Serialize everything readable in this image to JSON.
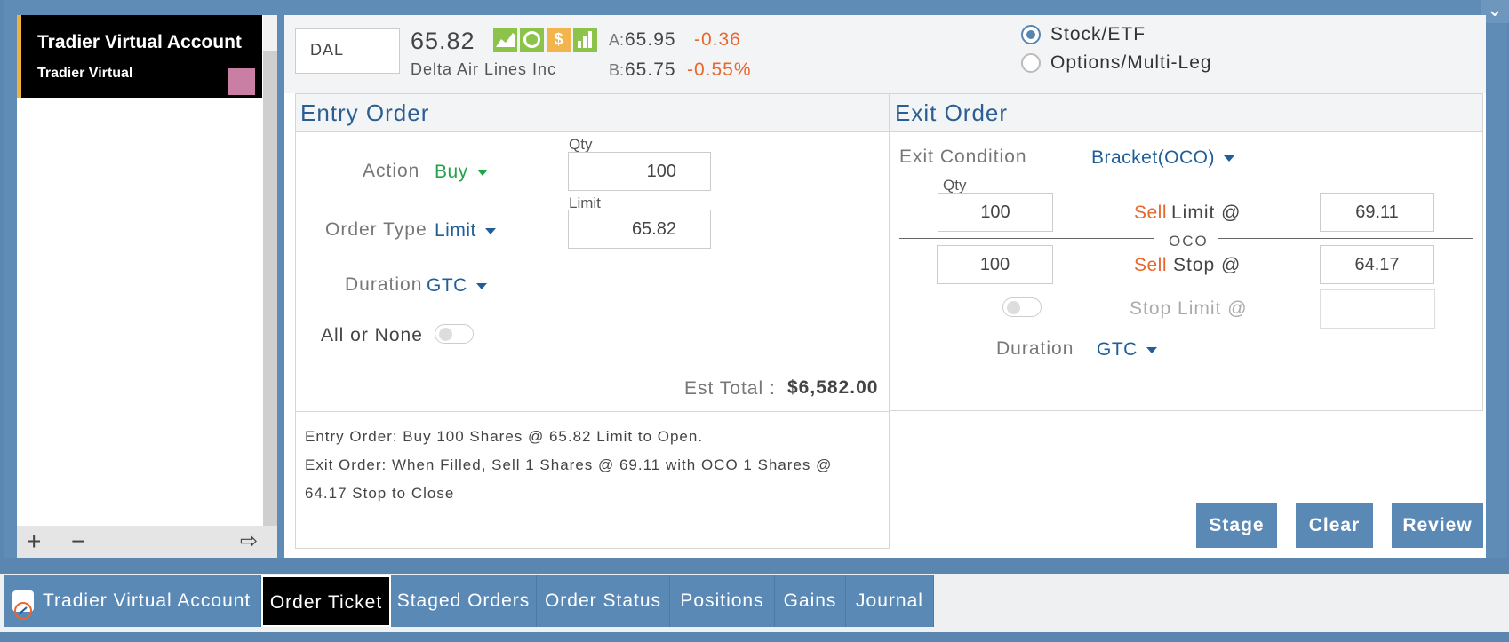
{
  "account_panel": {
    "account_name": "Tradier Virtual Account",
    "account_sub": "Tradier Virtual",
    "swatch_color": "#c97fa3",
    "footer": {
      "add_icon": "+",
      "remove_icon": "−",
      "logout_icon": "⇨"
    }
  },
  "quote": {
    "symbol": "DAL",
    "price": "65.82",
    "company": "Delta Air Lines Inc",
    "ask_label": "A:",
    "ask": "65.95",
    "bid_label": "B:",
    "bid": "65.75",
    "change": "-0.36",
    "change_pct": "-0.55%",
    "icons": [
      "chart-icon",
      "circle-icon",
      "dollar-icon",
      "bars-icon"
    ]
  },
  "instrument_type": {
    "options": [
      "Stock/ETF",
      "Options/Multi-Leg"
    ],
    "selected": "Stock/ETF"
  },
  "entry_order": {
    "title": "Entry Order",
    "action_label": "Action",
    "action_value": "Buy",
    "qty_label": "Qty",
    "qty_value": "100",
    "order_type_label": "Order Type",
    "order_type_value": "Limit",
    "limit_label": "Limit",
    "limit_value": "65.82",
    "duration_label": "Duration",
    "duration_value": "GTC",
    "aon_label": "All or None",
    "est_total_label": "Est Total :",
    "est_total_value": "$6,582.00"
  },
  "exit_order": {
    "title": "Exit Order",
    "exit_condition_label": "Exit Condition",
    "exit_condition_value": "Bracket(OCO)",
    "qty_label": "Qty",
    "limit_qty": "100",
    "limit_side": "Sell",
    "limit_label": "Limit @",
    "limit_price": "69.11",
    "oco_label": "OCO",
    "stop_qty": "100",
    "stop_side": "Sell",
    "stop_label": "Stop @",
    "stop_price": "64.17",
    "stop_limit_label": "Stop Limit @",
    "stop_limit_price": "",
    "duration_label": "Duration",
    "duration_value": "GTC"
  },
  "summary": {
    "entry": "Entry Order:  Buy  100 Shares @ 65.82 Limit to Open.",
    "exit_line1": "Exit Order: When Filled, Sell 1 Shares @ 69.11 with OCO 1 Shares @",
    "exit_line2": "64.17 Stop to Close"
  },
  "buttons": {
    "stage": "Stage",
    "clear": "Clear",
    "review": "Review"
  },
  "tabs": [
    {
      "label": "Tradier Virtual Account"
    },
    {
      "label": "Order Ticket",
      "active": true
    },
    {
      "label": "Staged Orders"
    },
    {
      "label": "Order Status"
    },
    {
      "label": "Positions"
    },
    {
      "label": "Gains"
    },
    {
      "label": "Journal"
    }
  ],
  "colors": {
    "accent": "#5b89b6",
    "negative": "#e8672f",
    "buy": "#25a34a",
    "link": "#1f5e99"
  }
}
